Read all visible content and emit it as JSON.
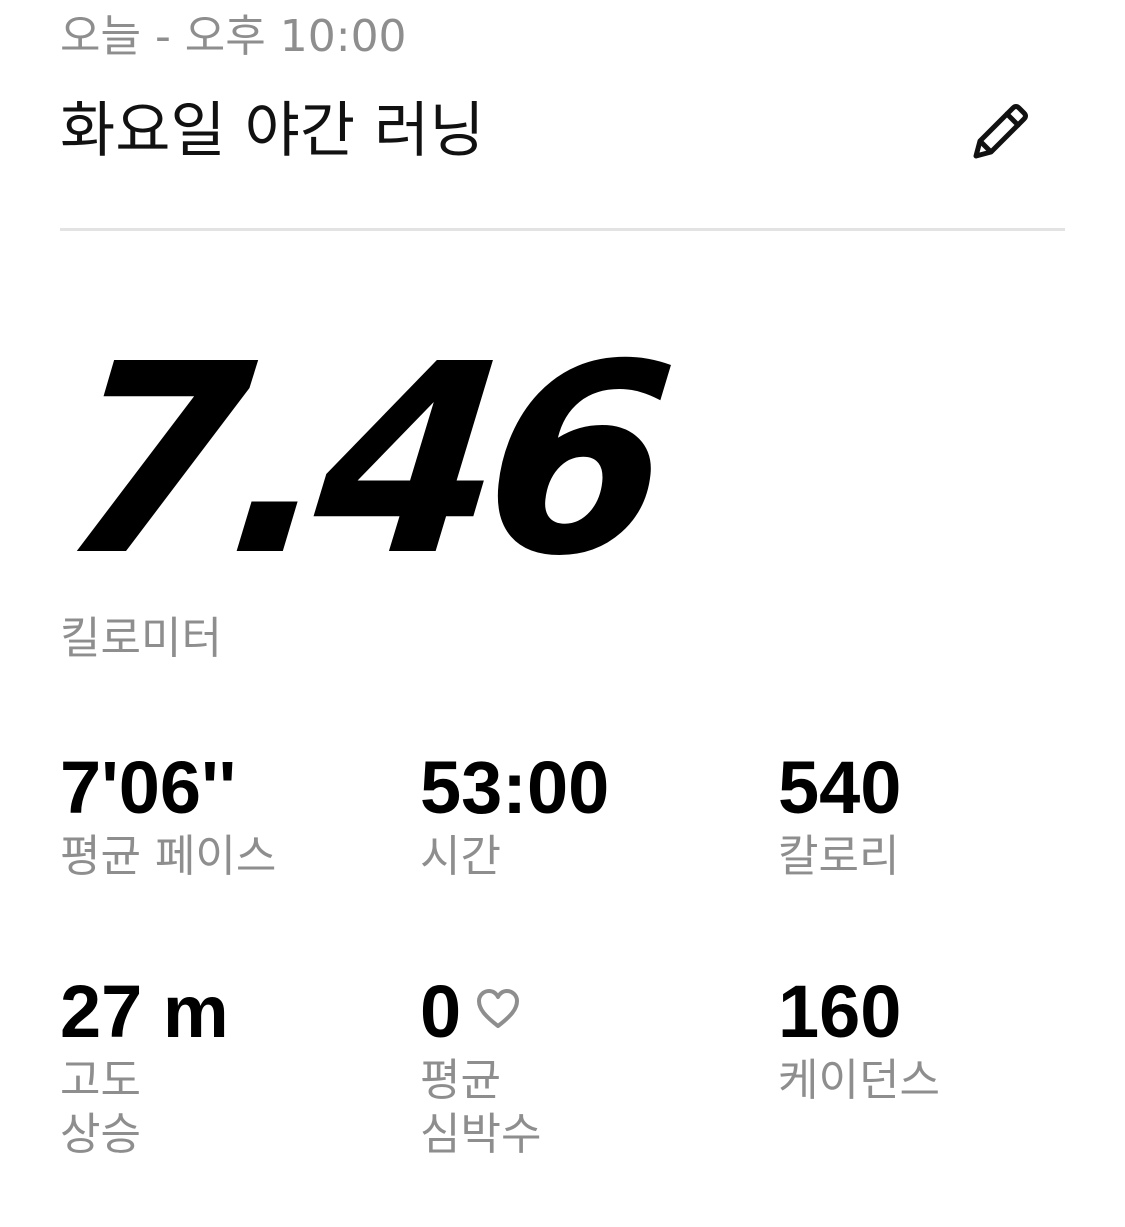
{
  "header": {
    "timestamp": "오늘 - 오후 10:00",
    "title": "화요일 야간 러닝",
    "edit_icon": "pencil-icon"
  },
  "summary": {
    "distance_value": "7.46",
    "distance_unit": "킬로미터"
  },
  "stats": [
    {
      "value": "7'06''",
      "label": "평균 페이스"
    },
    {
      "value": "53:00",
      "label": "시간"
    },
    {
      "value": "540",
      "label": "칼로리"
    },
    {
      "value": "27 m",
      "label": "고도\n상승"
    },
    {
      "value": "0",
      "label": "평균\n심박수",
      "icon": "heart-outline-icon"
    },
    {
      "value": "160",
      "label": "케이던스"
    }
  ],
  "colors": {
    "primary_text": "#000000",
    "secondary_text": "#8e8e8e",
    "divider": "#e3e3e3"
  }
}
